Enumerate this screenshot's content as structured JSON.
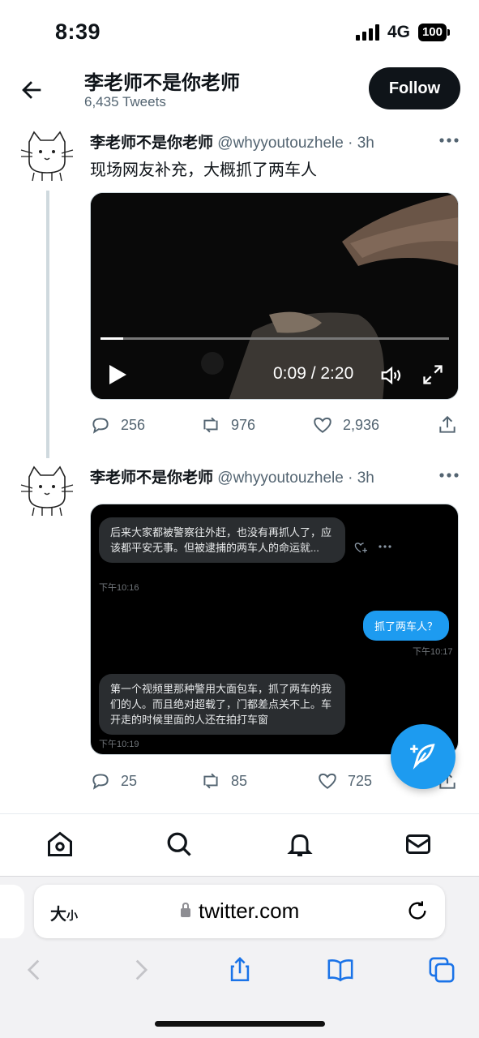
{
  "status": {
    "time": "8:39",
    "network": "4G",
    "battery": "100"
  },
  "header": {
    "title": "李老师不是你老师",
    "subtitle": "6,435 Tweets",
    "follow_label": "Follow"
  },
  "tweets": [
    {
      "name": "李老师不是你老师",
      "handle": "@whyyoutouzhele",
      "time": "· 3h",
      "text": "现场网友补充，大概抓了两车人",
      "video": {
        "time_display": "0:09 / 2:20",
        "progress": 0.065
      },
      "actions": {
        "replies": "256",
        "retweets": "976",
        "likes": "2,936"
      }
    },
    {
      "name": "李老师不是你老师",
      "handle": "@whyyoutouzhele",
      "time": "· 3h",
      "chat": [
        {
          "side": "left",
          "text": "后来大家都被警察往外赶，也没有再抓人了，应该都平安无事。但被逮捕的两车人的命运就...",
          "time": "下午10:16"
        },
        {
          "side": "right",
          "text": "抓了两车人？",
          "time": "下午10:17"
        },
        {
          "side": "left",
          "text": "第一个视频里那种警用大面包车，抓了两车的我们的人。而且绝对超载了，门都差点关不上。车开走的时候里面的人还在拍打车窗",
          "time": "下午10:19"
        }
      ],
      "actions": {
        "replies": "25",
        "retweets": "85",
        "likes": "725"
      }
    }
  ],
  "safari": {
    "text_size_label": "大",
    "text_size_small": "小",
    "url": "twitter.com"
  },
  "colors": {
    "accent": "#1d9bf0",
    "text": "#0f1419",
    "muted": "#536471"
  }
}
